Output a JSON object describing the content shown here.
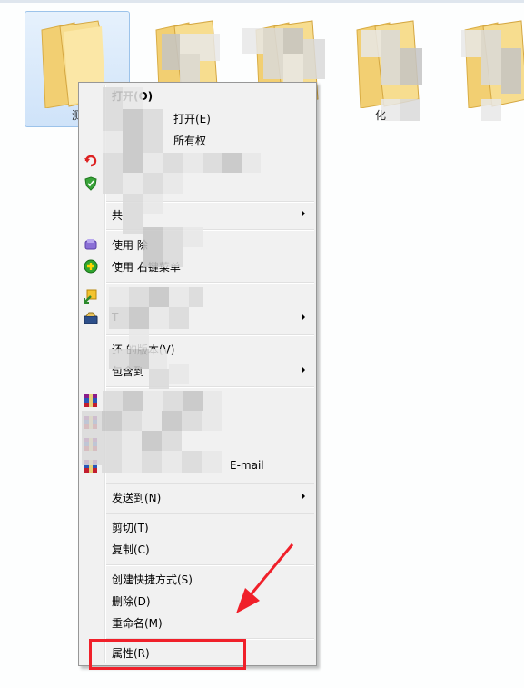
{
  "explorer": {
    "folders": [
      {
        "name": "测",
        "selected": true
      },
      {
        "name": "",
        "selected": false
      },
      {
        "name": "",
        "selected": false
      },
      {
        "name": "",
        "selected": false
      },
      {
        "name": "",
        "selected": false
      }
    ],
    "fourth_folder_caption_fragment": "化"
  },
  "context_menu": {
    "items": [
      {
        "id": "open",
        "label": "打开(O)",
        "bold": true,
        "submenu": false,
        "icon": ""
      },
      {
        "id": "open-with",
        "label": "打开(E)",
        "bold": false,
        "submenu": false,
        "icon": ""
      },
      {
        "id": "ownership",
        "label": "所有权",
        "bold": false,
        "submenu": false,
        "icon": ""
      },
      {
        "id": "blurred-a",
        "label": "",
        "bold": false,
        "submenu": false,
        "icon": "red-undo-icon"
      },
      {
        "id": "blurred-b",
        "label": "",
        "bold": false,
        "submenu": false,
        "icon": "shield-icon"
      },
      {
        "id": "share",
        "label": "共",
        "bold": false,
        "submenu": true,
        "icon": ""
      },
      {
        "id": "use-delete",
        "label": "使用                除",
        "bold": false,
        "submenu": false,
        "icon": "purple-eraser-icon"
      },
      {
        "id": "use-context",
        "label": "使用                右键菜单",
        "bold": false,
        "submenu": false,
        "icon": "green-plus-icon"
      },
      {
        "id": "blurred-c",
        "label": "",
        "bold": false,
        "submenu": false,
        "icon": "yellow-arrows-icon"
      },
      {
        "id": "blurred-d",
        "label": "T",
        "bold": false,
        "submenu": true,
        "icon": "toolbox-icon"
      },
      {
        "id": "restore",
        "label": "还          的版本(V)",
        "bold": false,
        "submenu": false,
        "icon": ""
      },
      {
        "id": "include",
        "label": "包含到",
        "bold": false,
        "submenu": true,
        "icon": ""
      },
      {
        "id": "rar-1",
        "label": "",
        "bold": false,
        "submenu": false,
        "icon": "winrar-icon"
      },
      {
        "id": "rar-2",
        "label": "",
        "bold": false,
        "submenu": false,
        "icon": "winrar-icon"
      },
      {
        "id": "rar-3",
        "label": "",
        "bold": false,
        "submenu": false,
        "icon": "winrar-icon"
      },
      {
        "id": "rar-email",
        "label": "E-mail",
        "bold": false,
        "submenu": false,
        "icon": "winrar-icon"
      },
      {
        "id": "send-to",
        "label": "发送到(N)",
        "bold": false,
        "submenu": true,
        "icon": ""
      },
      {
        "id": "cut",
        "label": "剪切(T)",
        "bold": false,
        "submenu": false,
        "icon": ""
      },
      {
        "id": "copy",
        "label": "复制(C)",
        "bold": false,
        "submenu": false,
        "icon": ""
      },
      {
        "id": "shortcut",
        "label": "创建快捷方式(S)",
        "bold": false,
        "submenu": false,
        "icon": ""
      },
      {
        "id": "delete",
        "label": "删除(D)",
        "bold": false,
        "submenu": false,
        "icon": ""
      },
      {
        "id": "rename",
        "label": "重命名(M)",
        "bold": false,
        "submenu": false,
        "icon": ""
      },
      {
        "id": "properties",
        "label": "属性(R)",
        "bold": false,
        "submenu": false,
        "icon": ""
      }
    ],
    "highlighted_item": "properties",
    "annotation_color": "#f0202a"
  }
}
